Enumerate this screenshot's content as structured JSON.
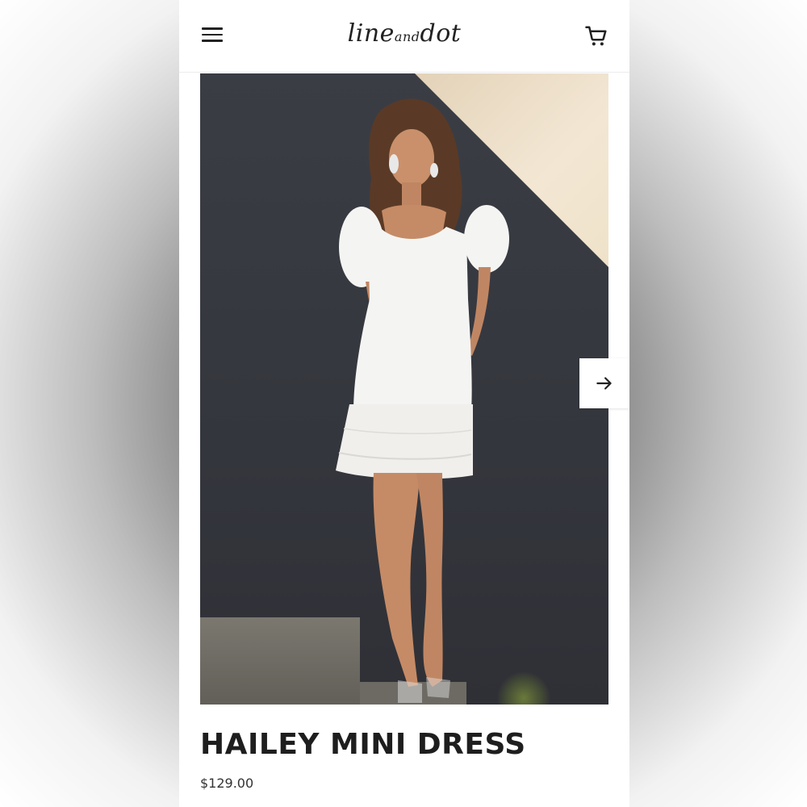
{
  "header": {
    "brand": "lineanddot",
    "brand_parts": {
      "line": "line",
      "and": "and",
      "dot": "dot"
    },
    "menu_icon": "hamburger-menu-icon",
    "cart_icon": "shopping-cart-icon"
  },
  "gallery": {
    "next_icon": "arrow-right-icon"
  },
  "product": {
    "name": "HAILEY MINI DRESS",
    "price": "$129.00"
  },
  "colors": {
    "text": "#1e1e1e",
    "background": "#ffffff",
    "wall": "#35373e",
    "dress": "#f4f4f2"
  }
}
